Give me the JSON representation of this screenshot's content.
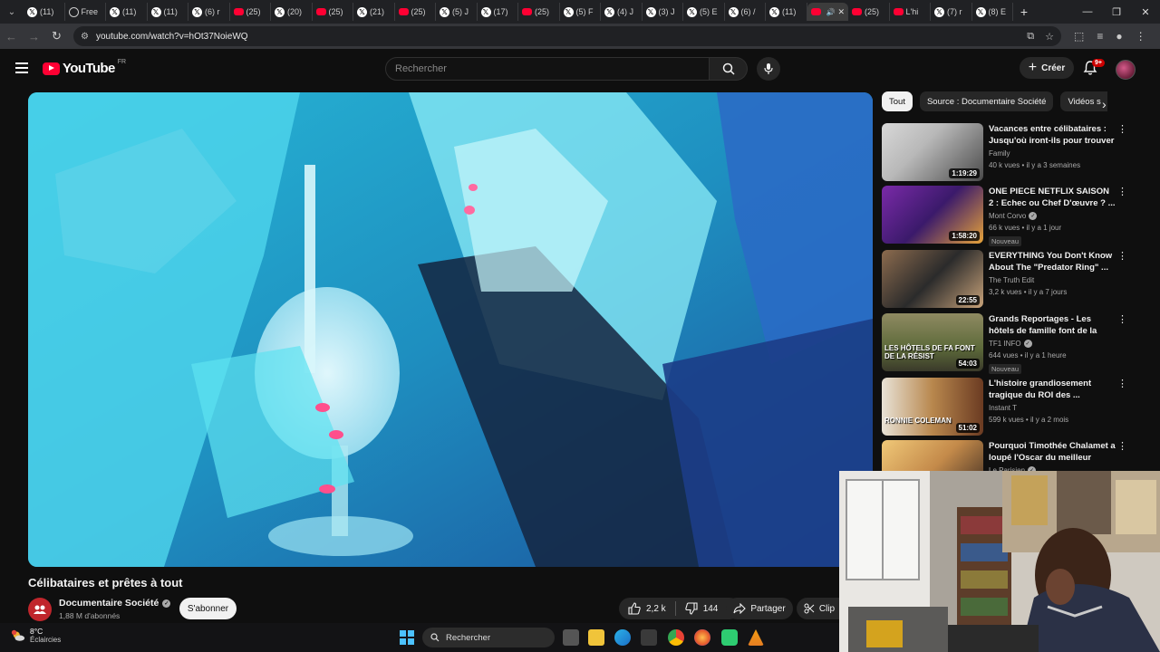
{
  "browser": {
    "tabs": [
      {
        "label": "(11)",
        "icon": "x-icon"
      },
      {
        "label": "Free",
        "icon": "globe-icon"
      },
      {
        "label": "(11)",
        "icon": "x-icon"
      },
      {
        "label": "(11)",
        "icon": "x-icon"
      },
      {
        "label": "(6) r",
        "icon": "x-icon"
      },
      {
        "label": "(25)",
        "icon": "youtube-icon"
      },
      {
        "label": "(20)",
        "icon": "x-icon"
      },
      {
        "label": "(25)",
        "icon": "youtube-icon"
      },
      {
        "label": "(21)",
        "icon": "x-icon"
      },
      {
        "label": "(25)",
        "icon": "youtube-icon"
      },
      {
        "label": "(5) J",
        "icon": "x-icon"
      },
      {
        "label": "(17)",
        "icon": "x-icon"
      },
      {
        "label": "(25)",
        "icon": "youtube-icon"
      },
      {
        "label": "(5) F",
        "icon": "x-icon"
      },
      {
        "label": "(4) J",
        "icon": "x-icon"
      },
      {
        "label": "(3) J",
        "icon": "x-icon"
      },
      {
        "label": "(5) E",
        "icon": "x-icon"
      },
      {
        "label": "(6) /",
        "icon": "x-icon"
      },
      {
        "label": "(11)",
        "icon": "x-icon"
      },
      {
        "label": "",
        "icon": "youtube-icon",
        "active": true
      },
      {
        "label": "(25)",
        "icon": "youtube-icon"
      },
      {
        "label": "L'hi",
        "icon": "youtube-icon"
      },
      {
        "label": "(7) r",
        "icon": "x-icon"
      },
      {
        "label": "(8) E",
        "icon": "x-icon"
      }
    ],
    "url": "youtube.com/watch?v=hOt37NoieWQ"
  },
  "yt": {
    "logo_text": "YouTube",
    "country": "FR",
    "search_placeholder": "Rechercher",
    "create_label": "Créer",
    "notif_count": "9+"
  },
  "video": {
    "title": "Célibataires et prêtes à tout",
    "channel": "Documentaire Société",
    "subscribers": "1,88 M d'abonnés",
    "subscribe_label": "S'abonner",
    "likes": "2,2 k",
    "dislikes": "144",
    "share_label": "Partager",
    "clip_label": "Clip"
  },
  "chips": [
    "Tout",
    "Source : Documentaire Société",
    "Vidéos s"
  ],
  "recommendations": [
    {
      "title": "Vacances entre célibataires : Jusqu'où iront-ils pour trouver ...",
      "channel": "Family",
      "meta": "40 k vues • il y a 3 semaines",
      "duration": "1:19:29",
      "verified": false,
      "badge": ""
    },
    {
      "title": "ONE PIECE NETFLIX SAISON 2 : Echec ou Chef D'œuvre ? ...",
      "channel": "Mont Corvo",
      "meta": "66 k vues • il y a 1 jour",
      "duration": "1:58:20",
      "verified": true,
      "badge": "Nouveau"
    },
    {
      "title": "EVERYTHING You Don't Know About The \"Predator Ring\" ...",
      "channel": "The Truth Edit",
      "meta": "3,2 k vues • il y a 7 jours",
      "duration": "22:55",
      "verified": false,
      "badge": ""
    },
    {
      "title": "Grands Reportages - Les hôtels de famille font de la résistanc...",
      "channel": "TF1 INFO",
      "meta": "644 vues • il y a 1 heure",
      "duration": "54:03",
      "verified": true,
      "badge": "Nouveau",
      "thumb_text": "LES HÔTELS DE FA FONT DE LA RÉSIST"
    },
    {
      "title": "L'histoire grandiosement tragique du ROI des ...",
      "channel": "Instant T",
      "meta": "599 k vues • il y a 2 mois",
      "duration": "51:02",
      "verified": false,
      "badge": "",
      "thumb_text": "RONNIE COLEMAN"
    },
    {
      "title": "Pourquoi Timothée Chalamet a loupé l'Oscar du meilleur acteur",
      "channel": "Le Parisien",
      "meta": "",
      "duration": "",
      "verified": true,
      "badge": ""
    }
  ],
  "taskbar": {
    "temperature": "8°C",
    "weather": "Éclaircies",
    "search_label": "Rechercher"
  },
  "colors": {
    "yt_red": "#ff0033",
    "background": "#0f0f0f",
    "chip_bg": "#272727"
  }
}
